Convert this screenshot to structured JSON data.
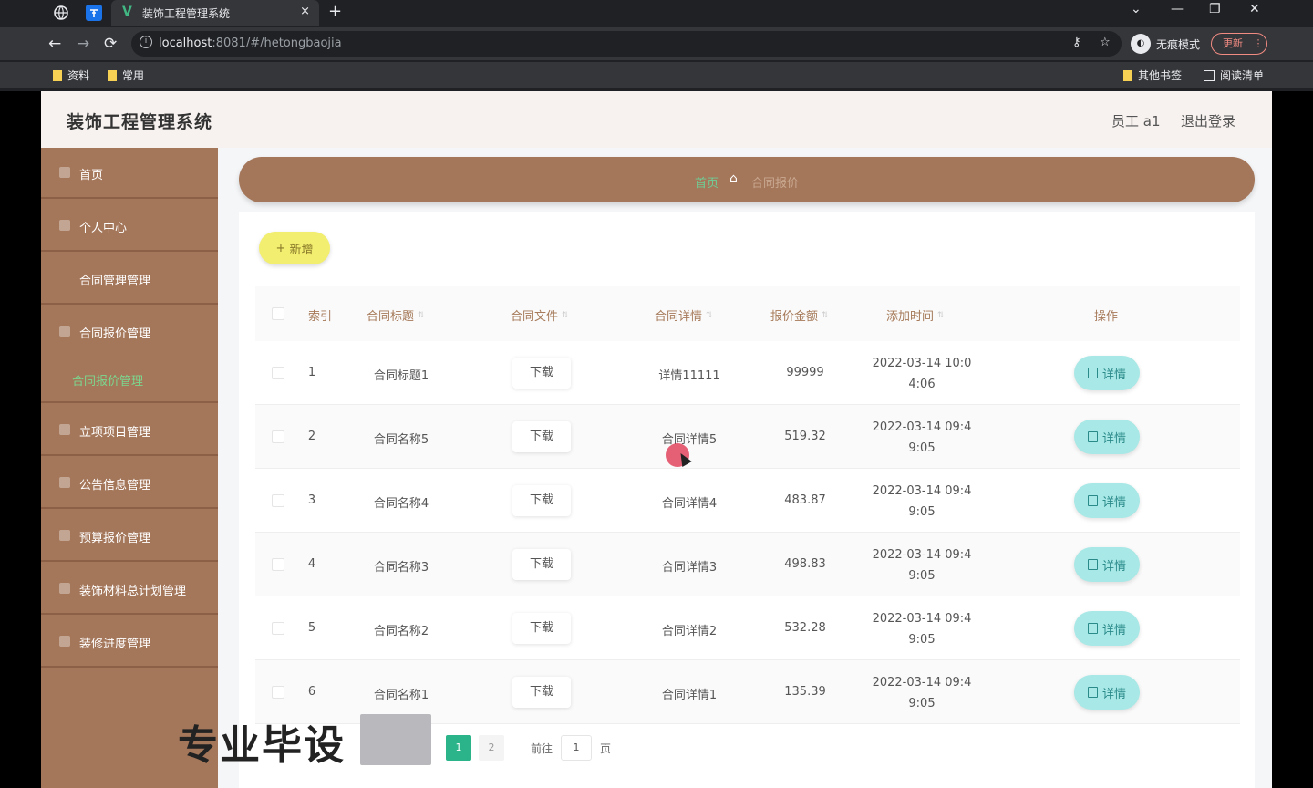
{
  "browser": {
    "tab_title": "装饰工程管理系统",
    "tab_favicon": "V",
    "url_host": "localhost",
    "url_rest": ":8081/#/hetongbaojia",
    "incognito_label": "无痕模式",
    "update_label": "更新",
    "bookmarks": [
      "资料",
      "常用"
    ],
    "other_bookmarks": "其他书签",
    "reading_list": "阅读清单",
    "close_glyph": "×",
    "new_tab_glyph": "+",
    "back_glyph": "←",
    "forward_glyph": "→",
    "reload_glyph": "⟳",
    "minimize_glyph": "—",
    "restore_glyph": "❐",
    "window_close_glyph": "✕",
    "dropdown_glyph": "⌄",
    "key_glyph": "⚷",
    "star_glyph": "☆",
    "menu_glyph": "⋮"
  },
  "header": {
    "title": "装饰工程管理系统",
    "user": "员工 a1",
    "logout": "退出登录"
  },
  "sidebar": {
    "items": [
      {
        "label": "首页"
      },
      {
        "label": "个人中心"
      },
      {
        "label": "合同管理管理"
      },
      {
        "label": "合同报价管理"
      },
      {
        "label": "合同报价管理"
      },
      {
        "label": "立项项目管理"
      },
      {
        "label": "公告信息管理"
      },
      {
        "label": "预算报价管理"
      },
      {
        "label": "装饰材料总计划管理"
      },
      {
        "label": "装修进度管理"
      }
    ]
  },
  "breadcrumb": {
    "home": "首页",
    "current": "合同报价"
  },
  "toolbar": {
    "add_label": "新增",
    "add_glyph": "+"
  },
  "table": {
    "headers": {
      "index": "索引",
      "title": "合同标题",
      "file": "合同文件",
      "detail": "合同详情",
      "amount": "报价金额",
      "time": "添加时间",
      "action": "操作"
    },
    "sort_glyph": "⇅",
    "download_label": "下载",
    "detail_label": "详情",
    "rows": [
      {
        "index": "1",
        "title": "合同标题1",
        "detail": "详情11111",
        "amount": "99999",
        "time": "2022-03-14 10:04:06"
      },
      {
        "index": "2",
        "title": "合同名称5",
        "detail": "合同详情5",
        "amount": "519.32",
        "time": "2022-03-14 09:49:05"
      },
      {
        "index": "3",
        "title": "合同名称4",
        "detail": "合同详情4",
        "amount": "483.87",
        "time": "2022-03-14 09:49:05"
      },
      {
        "index": "4",
        "title": "合同名称3",
        "detail": "合同详情3",
        "amount": "498.83",
        "time": "2022-03-14 09:49:05"
      },
      {
        "index": "5",
        "title": "合同名称2",
        "detail": "合同详情2",
        "amount": "532.28",
        "time": "2022-03-14 09:49:05"
      },
      {
        "index": "6",
        "title": "合同名称1",
        "detail": "合同详情1",
        "amount": "135.39",
        "time": "2022-03-14 09:49:05"
      }
    ]
  },
  "pagination": {
    "current_page": "1",
    "other_page": "2",
    "goto_label": "前往",
    "goto_value": "1",
    "page_suffix": "页"
  },
  "watermark": "专业毕设",
  "colors": {
    "sidebar": "#a4765a",
    "accent_green": "#2bb489",
    "add_button": "#f2ee6f",
    "detail_button": "#a8e8e6"
  }
}
